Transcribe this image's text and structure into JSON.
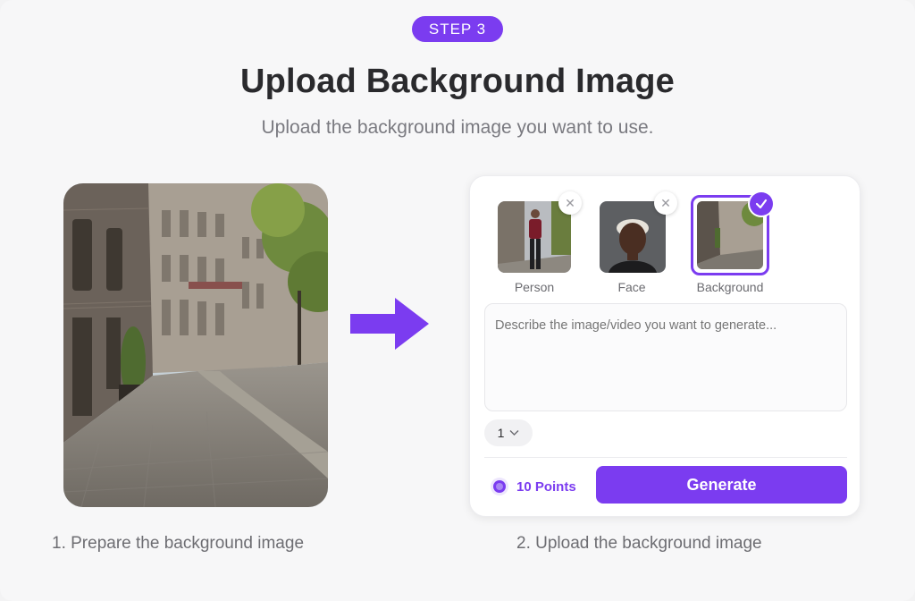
{
  "step": {
    "badge": "STEP 3"
  },
  "header": {
    "title": "Upload Background Image",
    "subtitle": "Upload the background image you want to use."
  },
  "captions": {
    "left": "1. Prepare the background image",
    "right": "2. Upload the background image"
  },
  "uploads": [
    {
      "label": "Person",
      "remove_icon": "close-icon",
      "selected": false
    },
    {
      "label": "Face",
      "remove_icon": "close-icon",
      "selected": false
    },
    {
      "label": "Background",
      "selected_icon": "check-icon",
      "selected": true
    }
  ],
  "prompt": {
    "placeholder": "Describe the image/video you want to generate...",
    "value": ""
  },
  "count_select": {
    "value": "1",
    "icon": "chevron-down-icon"
  },
  "points": {
    "label": "10 Points",
    "icon": "coin-icon"
  },
  "generate": {
    "label": "Generate"
  },
  "colors": {
    "accent": "#7b3cf0",
    "background": "#f7f7f8"
  }
}
